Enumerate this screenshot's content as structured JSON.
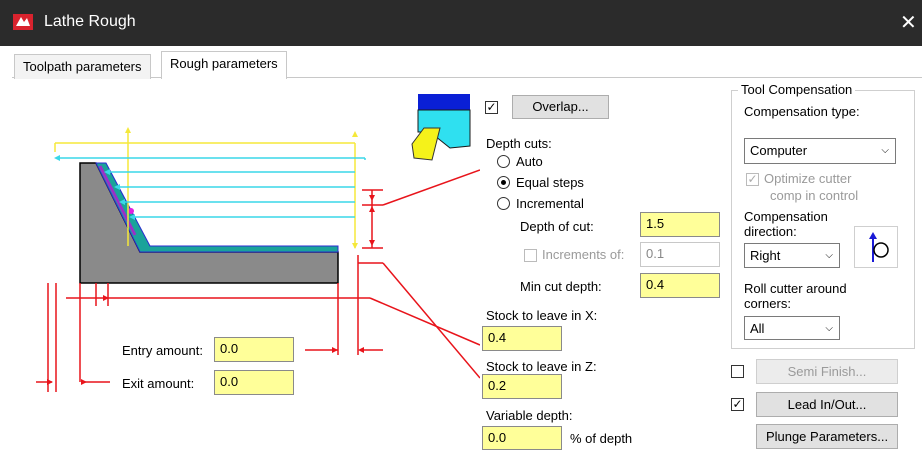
{
  "window": {
    "title": "Lathe Rough",
    "close_glyph": "✕"
  },
  "tabs": [
    {
      "label": "Toolpath parameters",
      "active": false
    },
    {
      "label": "Rough parameters",
      "active": true
    }
  ],
  "overlap": {
    "checked": true,
    "button_label": "Overlap..."
  },
  "depth_cuts": {
    "label": "Depth cuts:",
    "options": [
      "Auto",
      "Equal steps",
      "Incremental"
    ],
    "selected": "Equal steps"
  },
  "depth_of_cut": {
    "label": "Depth of cut:",
    "value": "1.5"
  },
  "increments_of": {
    "label": "Increments of:",
    "value": "0.1",
    "checked": false,
    "enabled": false
  },
  "min_cut_depth": {
    "label": "Min cut depth:",
    "value": "0.4"
  },
  "stock_x": {
    "label": "Stock to leave in X:",
    "value": "0.4"
  },
  "stock_z": {
    "label": "Stock to leave in Z:",
    "value": "0.2"
  },
  "variable_depth": {
    "label": "Variable depth:",
    "value": "0.0",
    "suffix": "% of depth"
  },
  "entry_amount": {
    "label": "Entry amount:",
    "value": "0.0"
  },
  "exit_amount": {
    "label": "Exit amount:",
    "value": "0.0"
  },
  "tool_compensation": {
    "title": "Tool Compensation",
    "type_label": "Compensation type:",
    "type_value": "Computer",
    "optimize_label_1": "Optimize cutter",
    "optimize_label_2": "comp in control",
    "optimize_checked": true,
    "direction_label": "Compensation direction:",
    "direction_value": "Right",
    "roll_label": "Roll cutter around corners:",
    "roll_value": "All"
  },
  "semi_finish": {
    "checked": false,
    "button_label": "Semi Finish..."
  },
  "lead_in_out": {
    "checked": true,
    "button_label": "Lead In/Out..."
  },
  "plunge_button": "Plunge Parameters...",
  "colors": {
    "titlebar": "#2b2b2b",
    "field_yellow": "#ffff99",
    "dim_red": "#e8141b",
    "dim_yellow": "#f5e83a",
    "dim_cyan": "#3ad7e8",
    "stock_teal": "#1aa39a",
    "part_gray": "#8a8a8a"
  },
  "icons": [
    "app-icon",
    "tool-insert-icon",
    "comp-direction-icon",
    "chevron-down-icon",
    "close-icon"
  ]
}
